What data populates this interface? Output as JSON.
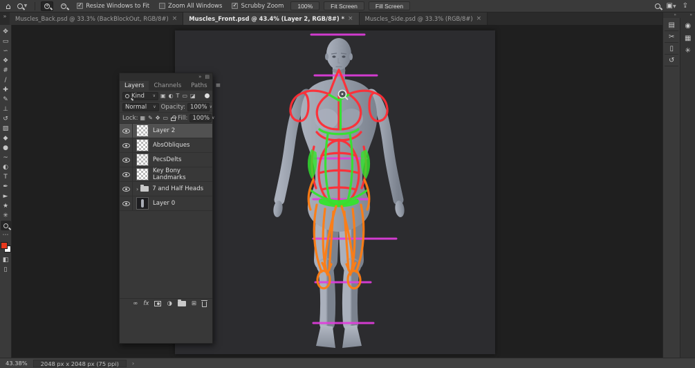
{
  "colors": {
    "overlay_guide": "#e13ddd",
    "overlay_red": "#ff2d35",
    "overlay_green": "#33e42e",
    "overlay_orange": "#ff7d12",
    "foreground_swatch": "#e8391d",
    "background_swatch": "#ffffff",
    "selection_highlight": "#515151"
  },
  "topbar": {
    "checkboxes": [
      {
        "label": "Resize Windows to Fit",
        "checked": true
      },
      {
        "label": "Zoom All Windows",
        "checked": false
      },
      {
        "label": "Scrubby Zoom",
        "checked": true
      }
    ],
    "buttons": {
      "zoom_100": "100%",
      "fit_screen": "Fit Screen",
      "fill_screen": "Fill Screen"
    }
  },
  "tabbar": {
    "overflow_chevron": "»",
    "close_glyph": "×",
    "tabs": [
      {
        "label": "Muscles_Back.psd @ 33.3% (BackBlockOut, RGB/8#)",
        "active": false
      },
      {
        "label": "Muscles_Front.psd @ 43.4% (Layer 2, RGB/8#) *",
        "active": true
      },
      {
        "label": "Muscles_Side.psd @ 33.3% (RGB/8#)",
        "active": false
      }
    ]
  },
  "toolbar": {
    "tools": [
      {
        "name": "move",
        "glyph": "✥"
      },
      {
        "name": "marquee",
        "glyph": "▭"
      },
      {
        "name": "lasso",
        "glyph": "∽"
      },
      {
        "name": "object-selection",
        "glyph": "❖"
      },
      {
        "name": "crop",
        "glyph": "#"
      },
      {
        "name": "eyedropper",
        "glyph": "∕"
      },
      {
        "name": "healing-brush",
        "glyph": "✚"
      },
      {
        "name": "brush",
        "glyph": "✎"
      },
      {
        "name": "clone-stamp",
        "glyph": "⊥"
      },
      {
        "name": "history-brush",
        "glyph": "↺"
      },
      {
        "name": "eraser",
        "glyph": "▨"
      },
      {
        "name": "gradient",
        "glyph": "◆"
      },
      {
        "name": "blur",
        "glyph": "●"
      },
      {
        "name": "smudge",
        "glyph": "~"
      },
      {
        "name": "dodge",
        "glyph": "◐"
      },
      {
        "name": "type",
        "glyph": "T"
      },
      {
        "name": "pen",
        "glyph": "✒"
      },
      {
        "name": "path-selection",
        "glyph": "►"
      },
      {
        "name": "shape",
        "glyph": "★"
      },
      {
        "name": "hand",
        "glyph": "✳"
      },
      {
        "name": "zoom",
        "glyph": "",
        "selected": true
      }
    ],
    "more_glyph": "⋯",
    "quick_mask_glyph": "◧",
    "screen_mode_glyph": "▯"
  },
  "layers_panel": {
    "collapse_glyph": "»",
    "titlebar_menu_glyph": "▤",
    "tabs": [
      {
        "label": "Layers",
        "active": true
      },
      {
        "label": "Channels",
        "active": false
      },
      {
        "label": "Paths",
        "active": false
      }
    ],
    "menu_glyph": "≡",
    "filter": {
      "kind_label": "Kind",
      "caret": "∨",
      "type_icons": [
        "▣",
        "◐",
        "T",
        "▭",
        "◪"
      ]
    },
    "blend_mode": "Normal",
    "opacity_label": "Opacity:",
    "opacity_value": "100%",
    "lock_label": "Lock:",
    "lock_icons": [
      "▦",
      "✎",
      "✥",
      "▭"
    ],
    "fill_label": "Fill:",
    "fill_value": "100%",
    "layers": [
      {
        "name": "Layer 2",
        "selected": true
      },
      {
        "name": "AbsObliques",
        "selected": false
      },
      {
        "name": "PecsDelts",
        "selected": false
      },
      {
        "name": "Key Bony Landmarks",
        "selected": false
      },
      {
        "name": "7 and Half Heads",
        "selected": false,
        "group": true,
        "caret": "›"
      },
      {
        "name": "Layer 0",
        "selected": false,
        "figure": true
      }
    ],
    "footer": {
      "link_glyph": "∞",
      "fx_label": "fx",
      "adjustment_glyph": "◑",
      "new_layer_glyph": "⊞"
    }
  },
  "right_dock": {
    "header_chevron": "»",
    "panel_buttons": [
      {
        "name": "libraries",
        "glyph": "▤"
      },
      {
        "name": "adjustments",
        "glyph": "✂"
      },
      {
        "name": "notes",
        "glyph": "▯"
      },
      {
        "name": "history",
        "glyph": "↺"
      }
    ],
    "strip_buttons": [
      {
        "name": "color",
        "glyph": "◉"
      },
      {
        "name": "patterns",
        "glyph": "▦"
      },
      {
        "name": "properties",
        "glyph": "✳"
      }
    ]
  },
  "statusbar": {
    "zoom_value": "43.38%",
    "doc_info": "2048 px x 2048 px (75 ppi)",
    "chevron": "›"
  }
}
